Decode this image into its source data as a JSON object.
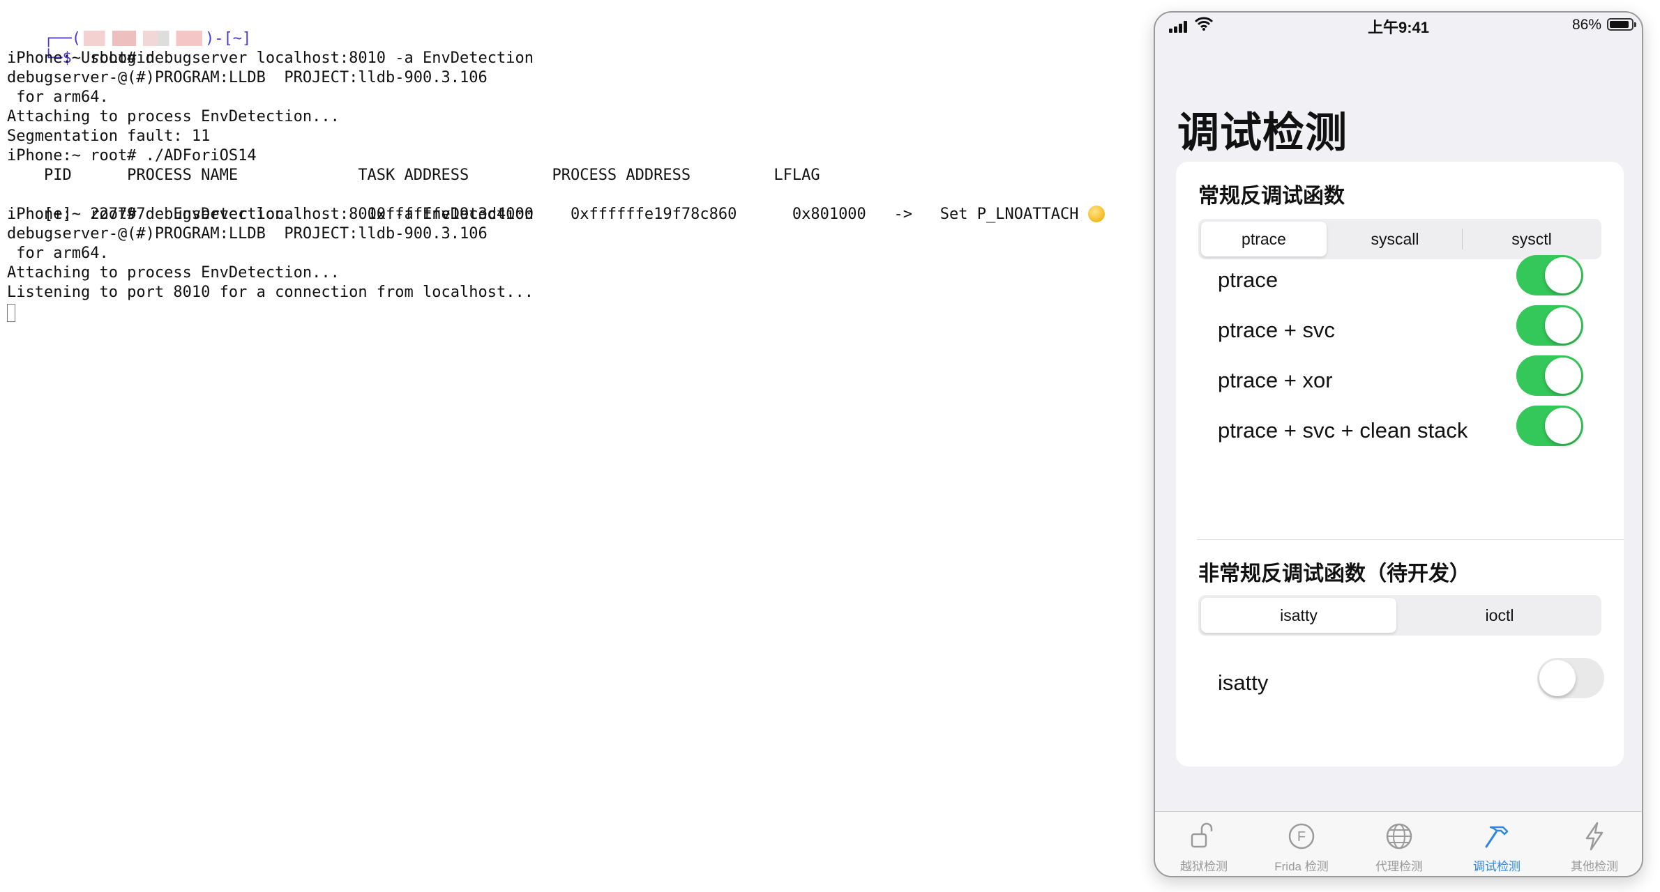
{
  "terminal": {
    "prompt_top_left": "┌──(",
    "prompt_top_right": ")-[~]",
    "prompt_bottom": "└─$",
    "command": "UsbLogin",
    "lines": [
      "iPhone:~ root# debugserver localhost:8010 -a EnvDetection",
      "debugserver-@(#)PROGRAM:LLDB  PROJECT:lldb-900.3.106",
      " for arm64.",
      "Attaching to process EnvDetection...",
      "Segmentation fault: 11",
      "iPhone:~ root# ./ADForiOS14",
      "    PID      PROCESS NAME             TASK ADDRESS         PROCESS ADDRESS         LFLAG",
      "[+]  227797   EnvDetection         0xffffffe19c3d4000    0xffffffe19f78c860      0x801000   ->   Set P_LNOATTACH",
      "iPhone:~ root# debugserver localhost:8010 -a EnvDetection",
      "debugserver-@(#)PROGRAM:LLDB  PROJECT:lldb-900.3.106",
      " for arm64.",
      "Attaching to process EnvDetection...",
      "Listening to port 8010 for a connection from localhost..."
    ],
    "emoji": "smiling-face"
  },
  "phone": {
    "status": {
      "time": "上午9:41",
      "battery": "86%",
      "battery_level": 0.86
    },
    "title": "调试检测",
    "section1": {
      "title": "常规反调试函数",
      "segments": [
        "ptrace",
        "syscall",
        "sysctl"
      ],
      "selected": "ptrace",
      "rows": [
        {
          "label": "ptrace",
          "on": true
        },
        {
          "label": "ptrace + svc",
          "on": true
        },
        {
          "label": "ptrace + xor",
          "on": true
        },
        {
          "label": "ptrace + svc + clean stack",
          "on": true
        }
      ]
    },
    "section2": {
      "title": "非常规反调试函数（待开发）",
      "segments": [
        "isatty",
        "ioctl"
      ],
      "selected": "isatty",
      "rows": [
        {
          "label": "isatty",
          "on": false
        }
      ]
    },
    "tabs": [
      {
        "label": "越狱检测",
        "icon": "unlock-icon"
      },
      {
        "label": "Frida 检测",
        "icon": "frida-f-icon"
      },
      {
        "label": "代理检测",
        "icon": "globe-icon"
      },
      {
        "label": "调试检测",
        "icon": "hammer-icon",
        "active": true
      },
      {
        "label": "其他检测",
        "icon": "bolt-icon"
      }
    ],
    "colors": {
      "toggle_on": "#34c759",
      "tab_active": "#2e86de",
      "tab_inactive": "#9a9a9a"
    }
  }
}
